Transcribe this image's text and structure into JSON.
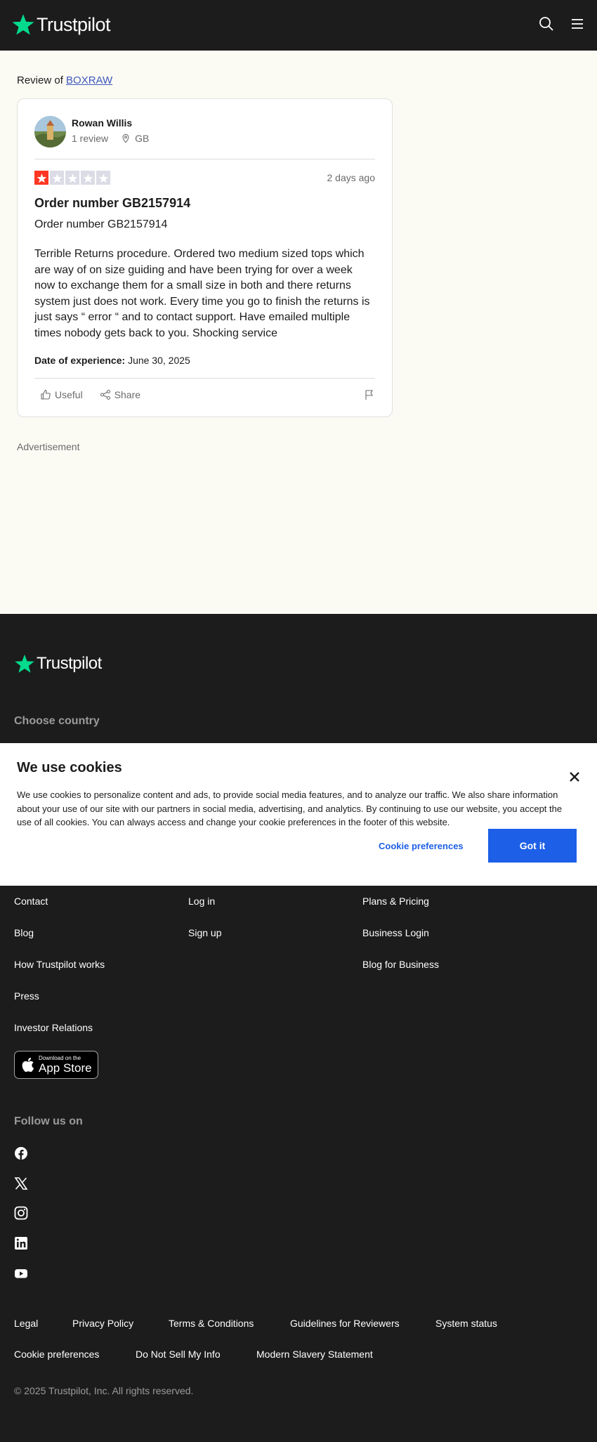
{
  "header": {
    "logo_text": "Trustpilot",
    "icons": [
      "search-icon",
      "menu-icon"
    ]
  },
  "review_of": {
    "prefix": "Review of",
    "company": "BOXRAW"
  },
  "review": {
    "reviewer_name": "Rowan Willis",
    "review_count": "1 review",
    "country": "GB",
    "rating": 1,
    "rating_max": 5,
    "date_ago": "2 days ago",
    "title": "Order number GB2157914",
    "body_line1": "Order number GB2157914",
    "body": "Terrible Returns procedure. Ordered two medium sized tops which are way of on size guiding and have been trying for over a week now to exchange them for a small size in both and there returns system just does not work. Every time you go to finish the returns is just says “ error “ and to contact support. Have emailed multiple times nobody gets back to you. Shocking service",
    "date_label": "Date of experience:",
    "date_value": "June 30, 2025",
    "useful_label": "Useful",
    "share_label": "Share"
  },
  "advertisement_label": "Advertisement",
  "colors": {
    "brand_green": "#04da8d",
    "star_red": "#ff3722",
    "link_blue": "#3c57bc",
    "button_blue": "#1d5fe6",
    "footer_bg": "#1c1c1c",
    "page_bg": "#fcfbf3"
  },
  "footer": {
    "logo_text": "Trustpilot",
    "choose_country": "Choose country",
    "col1": [
      "Contact",
      "Blog",
      "How Trustpilot works",
      "Press",
      "Investor Relations"
    ],
    "col2": [
      "Log in",
      "Sign up"
    ],
    "col3": [
      "Plans & Pricing",
      "Business Login",
      "Blog for Business"
    ],
    "app_store_small": "Download on the",
    "app_store_big": "App Store",
    "follow_us": "Follow us on",
    "social_icons": [
      "facebook-icon",
      "x-icon",
      "instagram-icon",
      "linkedin-icon",
      "youtube-icon"
    ],
    "legal_row1": [
      "Legal",
      "Privacy Policy",
      "Terms & Conditions",
      "Guidelines for Reviewers",
      "System status"
    ],
    "legal_row2": [
      "Cookie preferences",
      "Do Not Sell My Info",
      "Modern Slavery Statement"
    ],
    "copyright": "© 2025 Trustpilot, Inc. All rights reserved."
  },
  "cookie_banner": {
    "title": "We use cookies",
    "text": "We use cookies to personalize content and ads, to provide social media features, and to analyze our traffic. We also share information about your use of our site with our partners in social media, advertising, and analytics. By continuing to use our website, you accept the use of all cookies. You can always access and change your cookie preferences in the footer of this website.",
    "preferences_label": "Cookie preferences",
    "accept_label": "Got it"
  }
}
